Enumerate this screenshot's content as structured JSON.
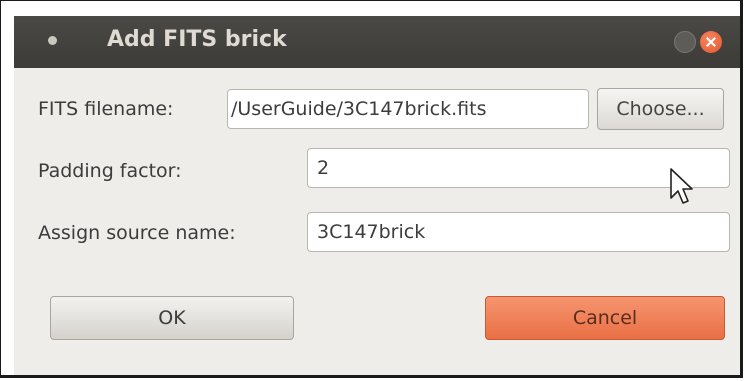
{
  "dialog": {
    "title": "Add FITS brick"
  },
  "form": {
    "filename_label": "FITS filename:",
    "filename_value": "/UserGuide/3C147brick.fits",
    "choose_label": "Choose...",
    "padding_label": "Padding factor:",
    "padding_value": "2",
    "source_label": "Assign source name:",
    "source_value": "3C147brick"
  },
  "buttons": {
    "ok_label": "OK",
    "cancel_label": "Cancel"
  },
  "colors": {
    "titlebar": "#3c3b37",
    "cancel_accent": "#ea6f44",
    "close_button": "#e35a2c"
  },
  "icons": [
    "window-menu-icon",
    "maximize-icon",
    "close-icon",
    "mouse-pointer-icon"
  ]
}
